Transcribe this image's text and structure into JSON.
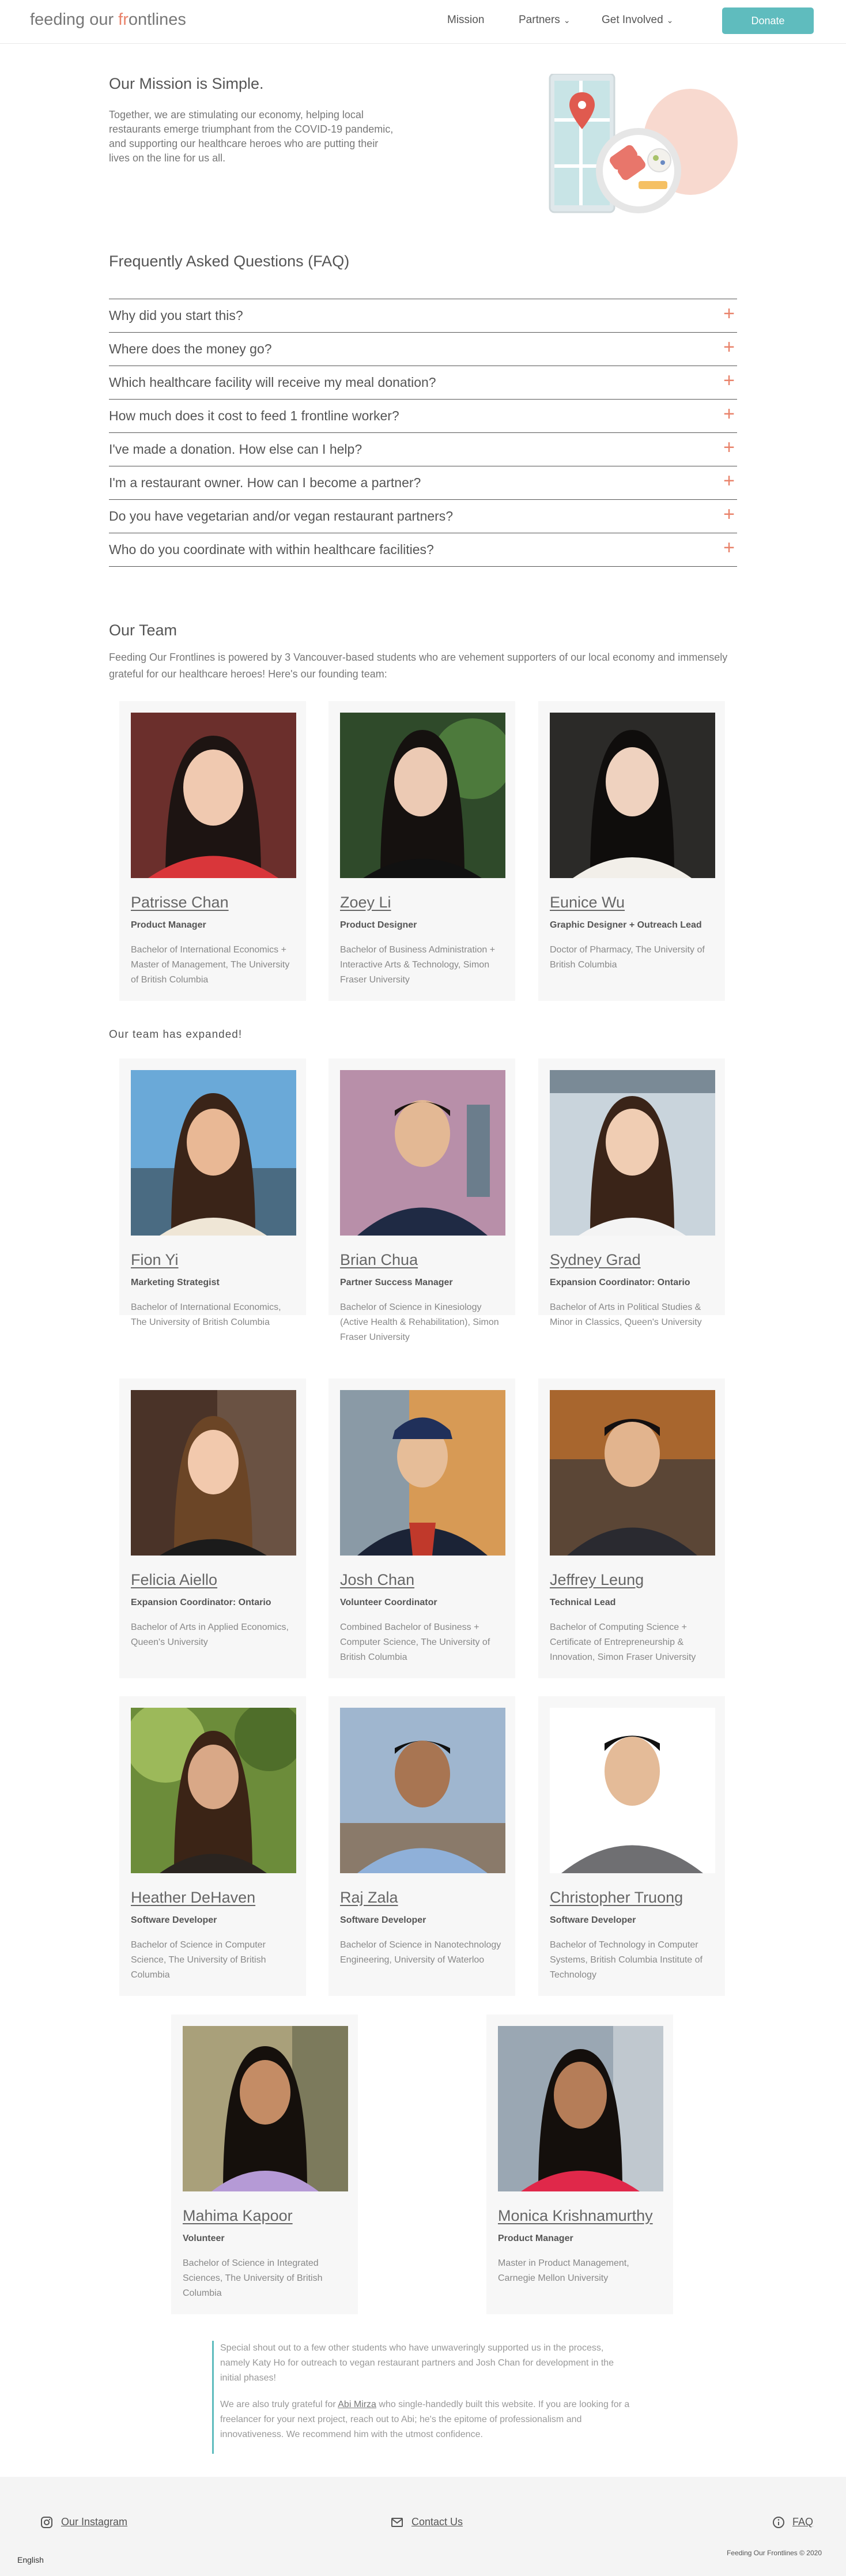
{
  "header": {
    "logo_pre": "feeding our ",
    "logo_accent": "fr",
    "logo_post": "ontlines",
    "nav_mission": "Mission",
    "nav_partners": "Partners",
    "nav_get_involved": "Get Involved",
    "donate": "Donate"
  },
  "mission": {
    "title": "Our Mission is Simple.",
    "body": "Together, we are stimulating our economy, helping local restaurants emerge triumphant from the COVID-19 pandemic, and supporting our healthcare heroes who are putting their lives on the line for us all."
  },
  "faq": {
    "title": "Frequently Asked Questions (FAQ)",
    "items": [
      "Why did you start this?",
      "Where does the money go?",
      "Which healthcare facility will receive my meal donation?",
      "How much does it cost to feed 1 frontline worker?",
      "I've made a donation. How else can I help?",
      "I'm a restaurant owner. How can I become a partner?",
      "Do you have vegetarian and/or vegan restaurant partners?",
      "Who do you coordinate with within healthcare facilities?"
    ]
  },
  "team": {
    "title": "Our Team",
    "intro": "Feeding Our Frontlines is powered by 3 Vancouver-based students who are vehement supporters of our local economy and immensely grateful for our healthcare heroes! Here's our founding team:",
    "expanded_heading": "Our team has expanded!",
    "members": [
      {
        "name": "Patrisse Chan",
        "role": "Product Manager",
        "education": "Bachelor of International Economics + Master of Management, The University of British Columbia"
      },
      {
        "name": "Zoey Li",
        "role": "Product Designer",
        "education": "Bachelor of Business Administration + Interactive Arts & Technology, Simon Fraser University"
      },
      {
        "name": "Eunice Wu",
        "role": "Graphic Designer + Outreach Lead",
        "education": "Doctor of Pharmacy, The University of British Columbia"
      },
      {
        "name": "Fion Yi",
        "role": "Marketing Strategist",
        "education": "Bachelor of International Economics, The University of British Columbia"
      },
      {
        "name": "Brian Chua",
        "role": "Partner Success Manager",
        "education": "Bachelor of Science in Kinesiology (Active Health & Rehabilitation), Simon Fraser University"
      },
      {
        "name": "Sydney Grad",
        "role": "Expansion Coordinator: Ontario",
        "education": "Bachelor of Arts in Political Studies & Minor in Classics, Queen's University"
      },
      {
        "name": "Felicia Aiello",
        "role": "Expansion Coordinator: Ontario",
        "education": "Bachelor of Arts in Applied Economics, Queen's University"
      },
      {
        "name": "Josh Chan",
        "role": "Volunteer Coordinator",
        "education": "Combined Bachelor of Business + Computer Science, The University of British Columbia"
      },
      {
        "name": "Jeffrey Leung",
        "role": "Technical Lead",
        "education": "Bachelor of Computing Science + Certificate of Entrepreneurship & Innovation, Simon Fraser University"
      },
      {
        "name": "Heather DeHaven",
        "role": "Software Developer",
        "education": "Bachelor of Science in Computer Science, The University of British Columbia"
      },
      {
        "name": "Raj Zala",
        "role": "Software Developer",
        "education": "Bachelor of Science in Nanotechnology Engineering, University of Waterloo"
      },
      {
        "name": "Christopher Truong",
        "role": "Software Developer",
        "education": "Bachelor of Technology in Computer Systems, British Columbia Institute of Technology"
      },
      {
        "name": "Mahima Kapoor",
        "role": "Volunteer",
        "education": "Bachelor of Science in Integrated Sciences, The University of British Columbia"
      },
      {
        "name": "Monica Krishnamurthy",
        "role": "Product Manager",
        "education": "Master in Product Management, Carnegie Mellon University"
      }
    ]
  },
  "shout": {
    "p1": "Special shout out to a few other students who have unwaveringly supported us in the process, namely Katy Ho for outreach to vegan restaurant partners and Josh Chan for development in the initial phases!",
    "p2_pre": "We are also truly grateful for ",
    "p2_link": "Abi Mirza",
    "p2_post": " who single-handedly built this website. If you are looking for a freelancer for your next project, reach out to Abi; he's the epitome of professionalism and innovativeness. We recommend him with the utmost confidence."
  },
  "footer": {
    "instagram": "Our Instagram",
    "contact": "Contact Us",
    "faq": "FAQ",
    "copyright": "Feeding Our Frontlines © 2020",
    "language": "English"
  },
  "colors": {
    "accent": "#e9836b",
    "teal": "#5fbcbe"
  }
}
